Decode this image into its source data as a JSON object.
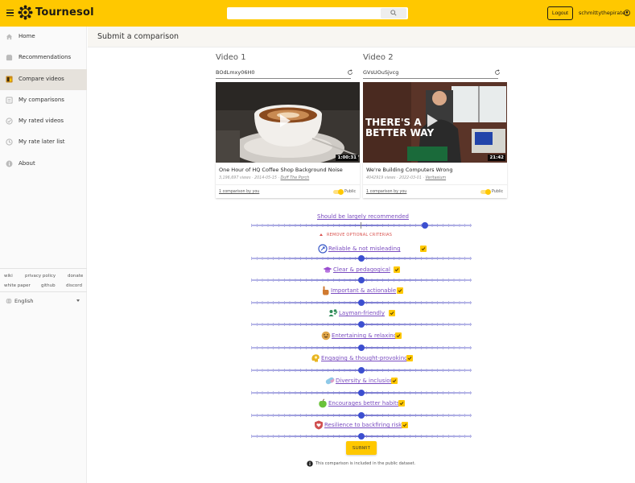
{
  "app": {
    "brand": "Tournesol",
    "logout_label": "Logout",
    "username": "schmittythepirate"
  },
  "sidebar": {
    "items": [
      {
        "label": "Home",
        "icon": "home-icon",
        "active": false
      },
      {
        "label": "Recommendations",
        "icon": "recommendations-icon",
        "active": false
      },
      {
        "label": "Compare videos",
        "icon": "compare-icon",
        "active": true
      },
      {
        "label": "My comparisons",
        "icon": "list-icon",
        "active": false
      },
      {
        "label": "My rated videos",
        "icon": "rated-icon",
        "active": false
      },
      {
        "label": "My rate later list",
        "icon": "rate-later-icon",
        "active": false
      },
      {
        "label": "About",
        "icon": "info-icon",
        "active": false
      }
    ],
    "footer_links": [
      "wiki",
      "privacy policy",
      "donate",
      "white paper",
      "github",
      "discord"
    ],
    "language": "English"
  },
  "page": {
    "title": "Submit a comparison"
  },
  "videos": [
    {
      "heading": "Video 1",
      "id": "BOdLmxy06H0",
      "duration": "1:00:31",
      "title": "One Hour of HQ Coffee Shop Background Noise",
      "views": "3,196,697 views",
      "date": "2014-05-15",
      "uploader": "Duff The Porch",
      "comparisons": "1 comparison by you",
      "visibility": "Public"
    },
    {
      "heading": "Video 2",
      "id": "GVsUOuSjvcg",
      "duration": "21:42",
      "thumb_text_1": "THERE'S A",
      "thumb_text_2": "BETTER WAY",
      "title": "We're Building Computers Wrong",
      "views": "4042919 views",
      "date": "2022-03-01",
      "uploader": "Veritasium",
      "comparisons": "1 comparison by you",
      "visibility": "Public"
    }
  ],
  "criteria": {
    "main": {
      "label": "Should be largely recommended",
      "value": 0.79
    },
    "remove_optional_label": "REMOVE OPTIONAL CRITERIAS",
    "optional": [
      {
        "label": "Reliable & not misleading",
        "icon": "reliable-icon",
        "value": 0.5
      },
      {
        "label": "Clear & pedagogical",
        "icon": "graduation-cap-icon",
        "value": 0.5
      },
      {
        "label": "Important & actionable",
        "icon": "pointing-hand-icon",
        "value": 0.5
      },
      {
        "label": "Layman-friendly",
        "icon": "people-icon",
        "value": 0.5
      },
      {
        "label": "Entertaining & relaxing",
        "icon": "smiley-icon",
        "value": 0.5
      },
      {
        "label": "Engaging & thought-provoking",
        "icon": "brain-icon",
        "value": 0.5
      },
      {
        "label": "Diversity & inclusion",
        "icon": "diversity-icon",
        "value": 0.5
      },
      {
        "label": "Encourages better habits",
        "icon": "apple-icon",
        "value": 0.5
      },
      {
        "label": "Resilience to backfiring risks",
        "icon": "shield-heart-icon",
        "value": 0.5
      }
    ]
  },
  "submit_label": "SUBMIT",
  "dataset_notice": "This comparison is included in the public dataset."
}
